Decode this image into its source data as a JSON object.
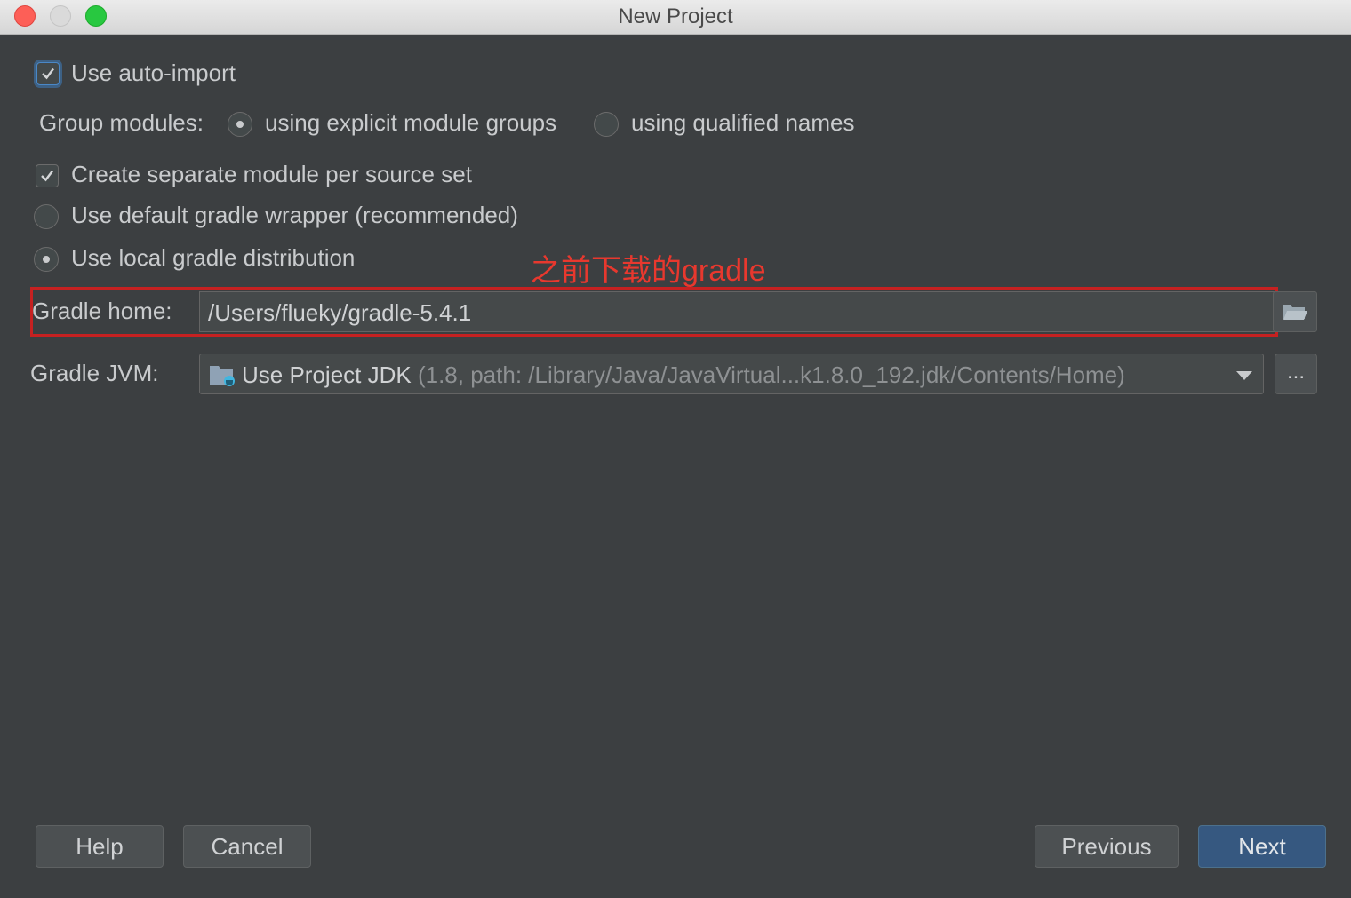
{
  "window": {
    "title": "New Project"
  },
  "options": {
    "auto_import": {
      "label": "Use auto-import",
      "checked": true
    },
    "group_modules": {
      "label": "Group modules:",
      "options": [
        "using explicit module groups",
        "using qualified names"
      ],
      "selected": "using explicit module groups"
    },
    "separate_module": {
      "label": "Create separate module per source set",
      "checked": true
    },
    "gradle_source": {
      "options": [
        "Use default gradle wrapper (recommended)",
        "Use local gradle distribution"
      ],
      "selected": "Use local gradle distribution"
    }
  },
  "annotation": {
    "text": "之前下载的gradle",
    "color": "#e8382e"
  },
  "gradle_home": {
    "label": "Gradle home:",
    "value": "/Users/flueky/gradle-5.4.1",
    "browse_icon": "folder-open-icon"
  },
  "gradle_jvm": {
    "label": "Gradle JVM:",
    "value": "Use Project JDK",
    "detail": "(1.8, path: /Library/Java/JavaVirtual...k1.8.0_192.jdk/Contents/Home)",
    "icon": "project-jdk-folder-icon",
    "more_label": "..."
  },
  "buttons": {
    "help": "Help",
    "cancel": "Cancel",
    "previous": "Previous",
    "next": "Next"
  },
  "colors": {
    "background": "#3c3f41",
    "primary_button": "#365880",
    "highlight_box": "#c62121"
  }
}
